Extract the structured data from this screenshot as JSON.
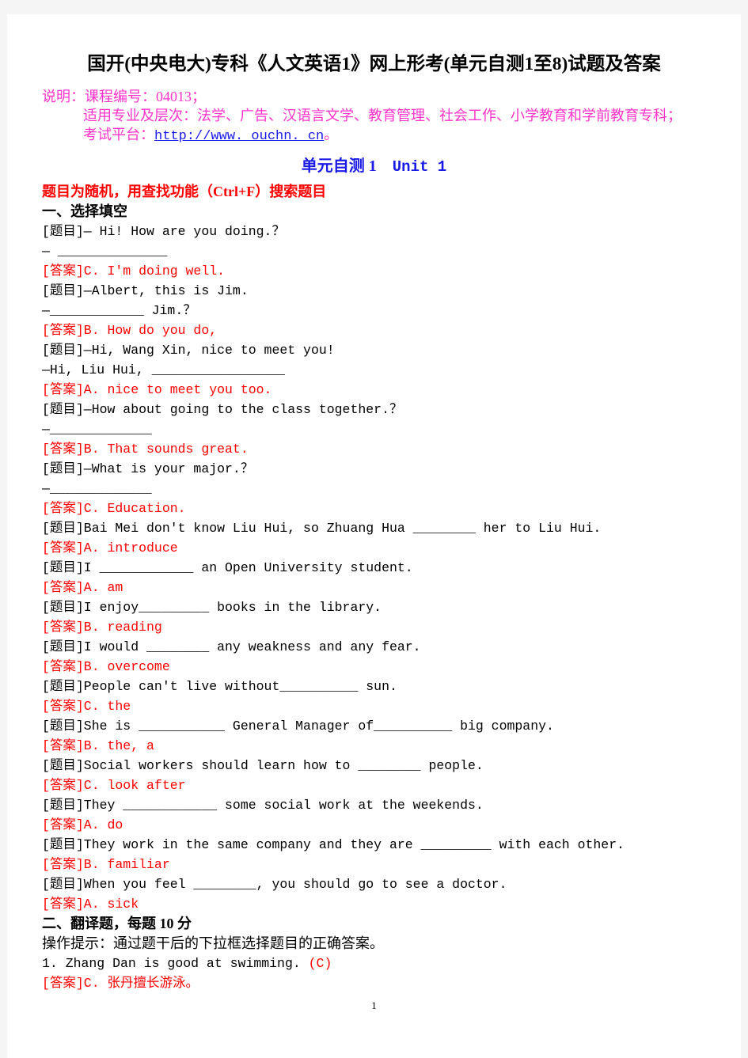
{
  "document": {
    "title": "国开(中央电大)专科《人文英语1》网上形考(单元自测1至8)试题及答案",
    "page_number": "1"
  },
  "notice": {
    "line1": "说明：课程编号：04013；",
    "line2": "适用专业及层次：法学、广告、汉语言文学、教育管理、社会工作、小学教育和学前教育专科；",
    "line3_label": "考试平台：",
    "line3_url": "http://www. ouchn. cn",
    "line3_tail": "。"
  },
  "unit": {
    "heading": "单元自测 1",
    "heading_en": "Unit 1",
    "search_tip": "题目为随机，用查找功能（Ctrl+F）搜索题目"
  },
  "section_one": {
    "header": "一、选择填空",
    "items": [
      {
        "type": "question",
        "text": "[题目]— Hi! How are you doing.？"
      },
      {
        "type": "question",
        "text": "— ______________"
      },
      {
        "type": "answer",
        "text": "[答案]C. I'm doing well."
      },
      {
        "type": "question",
        "text": "[题目]—Albert, this is Jim."
      },
      {
        "type": "question",
        "text": "—____________ Jim.？"
      },
      {
        "type": "answer",
        "text": "[答案]B. How do you do,"
      },
      {
        "type": "question",
        "text": "[题目]—Hi, Wang Xin, nice to meet you!"
      },
      {
        "type": "question",
        "text": "—Hi, Liu Hui, _________________"
      },
      {
        "type": "answer",
        "text": "[答案]A. nice to meet you too."
      },
      {
        "type": "question",
        "text": "[题目]—How about going to the class together.？"
      },
      {
        "type": "question",
        "text": "—_____________"
      },
      {
        "type": "answer",
        "text": "[答案]B. That sounds great."
      },
      {
        "type": "question",
        "text": "[题目]—What is your major.？"
      },
      {
        "type": "question",
        "text": "—_____________"
      },
      {
        "type": "answer",
        "text": "[答案]C. Education."
      },
      {
        "type": "question",
        "text": "[题目]Bai Mei don't know Liu Hui, so Zhuang Hua ________ her to Liu Hui."
      },
      {
        "type": "answer",
        "text": "[答案]A. introduce"
      },
      {
        "type": "question",
        "text": "[题目]I ____________ an Open University student."
      },
      {
        "type": "answer",
        "text": "[答案]A. am"
      },
      {
        "type": "question",
        "text": "[题目]I enjoy_________ books in the library."
      },
      {
        "type": "answer",
        "text": "[答案]B. reading"
      },
      {
        "type": "question",
        "text": "[题目]I would ________ any weakness and any fear."
      },
      {
        "type": "answer",
        "text": "[答案]B. overcome"
      },
      {
        "type": "question",
        "text": "[题目]People can't live without__________ sun."
      },
      {
        "type": "answer",
        "text": "[答案]C. the"
      },
      {
        "type": "question",
        "text": "[题目]She is ___________ General Manager of__________ big company."
      },
      {
        "type": "answer",
        "text": "[答案]B. the, a"
      },
      {
        "type": "question",
        "text": "[题目]Social workers should learn how to ________ people."
      },
      {
        "type": "answer",
        "text": "[答案]C. look after"
      },
      {
        "type": "question",
        "text": "[题目]They ____________ some social work at the weekends."
      },
      {
        "type": "answer",
        "text": "[答案]A. do"
      },
      {
        "type": "question",
        "text": "[题目]They work in the same company and they are _________ with each other."
      },
      {
        "type": "answer",
        "text": "[答案]B. familiar"
      },
      {
        "type": "question",
        "text": "[题目]When you feel ________, you should go to see a doctor."
      },
      {
        "type": "answer",
        "text": "[答案]A. sick"
      }
    ]
  },
  "section_two": {
    "header": "二、翻译题，每题 10 分",
    "operation_tip": "操作提示：通过题干后的下拉框选择题目的正确答案。",
    "item_1_text": "1. Zhang Dan is good at swimming. ",
    "item_1_mark": "(C)",
    "item_1_answer": "[答案]C. 张丹擅长游泳。"
  }
}
